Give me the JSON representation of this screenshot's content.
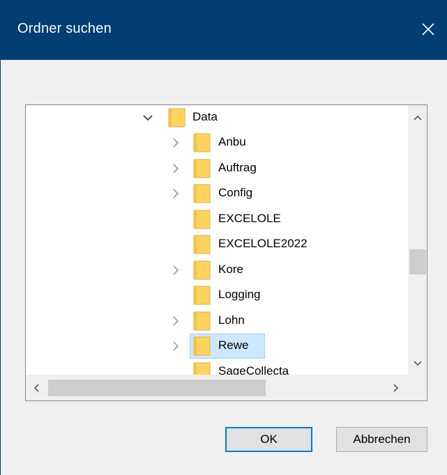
{
  "window": {
    "title": "Ordner suchen",
    "title_bar_color": "#003e73"
  },
  "tree": {
    "root": {
      "label": "Data",
      "expanded": true
    },
    "children": [
      {
        "label": "Anbu",
        "has_children": true,
        "selected": false
      },
      {
        "label": "Auftrag",
        "has_children": true,
        "selected": false
      },
      {
        "label": "Config",
        "has_children": true,
        "selected": false
      },
      {
        "label": "EXCELOLE",
        "has_children": false,
        "selected": false
      },
      {
        "label": "EXCELOLE2022",
        "has_children": false,
        "selected": false
      },
      {
        "label": "Kore",
        "has_children": true,
        "selected": false
      },
      {
        "label": "Logging",
        "has_children": false,
        "selected": false
      },
      {
        "label": "Lohn",
        "has_children": true,
        "selected": false
      },
      {
        "label": "Rewe",
        "has_children": true,
        "selected": true
      },
      {
        "label": "SageCollecta",
        "has_children": false,
        "selected": false
      }
    ],
    "selection_color": "#cce8ff",
    "folder_color": "#ffd35e"
  },
  "buttons": {
    "ok_label": "OK",
    "cancel_label": "Abbrechen"
  }
}
